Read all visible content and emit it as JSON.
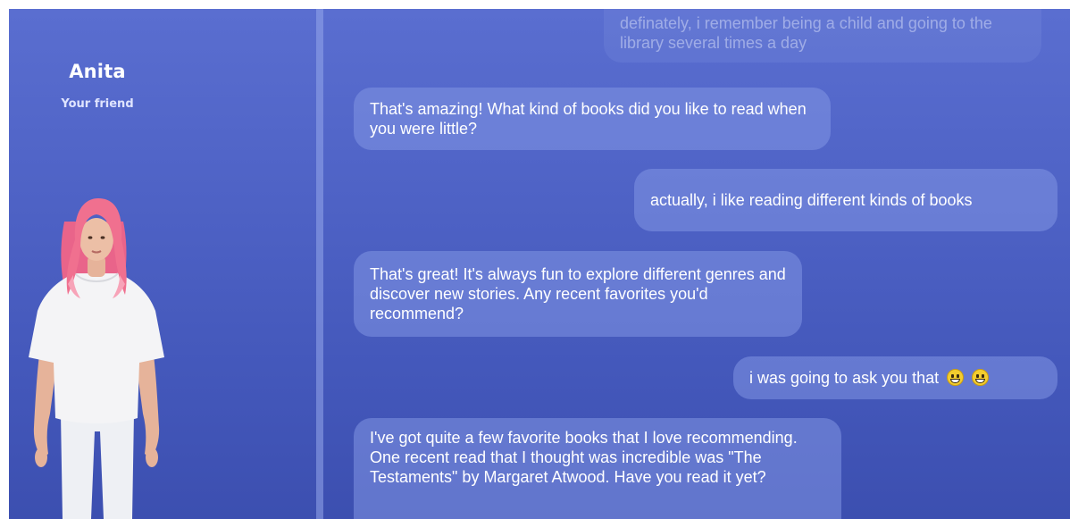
{
  "contact": {
    "name": "Anita",
    "role": "Your friend",
    "hair_color": "#f0708f",
    "shirt_color": "#f4f4f6"
  },
  "messages": [
    {
      "sender": "user",
      "text": "definately, i remember being a child and going to the library several times a day"
    },
    {
      "sender": "friend",
      "text": "That's amazing! What kind of books did you like to read when you were little?"
    },
    {
      "sender": "user",
      "text": "actually, i like reading different kinds of books"
    },
    {
      "sender": "friend",
      "text": "That's great! It's always fun to explore different genres and discover new stories. Any recent favorites you'd recommend?"
    },
    {
      "sender": "user",
      "text": "i was going to ask you that",
      "emojis": [
        "grinning-face-emoji",
        "grinning-face-emoji"
      ]
    },
    {
      "sender": "friend",
      "text": "I've got quite a few favorite books that I love recommending. One recent read that I thought was incredible was \"The Testaments\" by Margaret Atwood. Have you read it yet?"
    }
  ],
  "colors": {
    "background_top": "#5a6ed0",
    "background_bottom": "#3c4fb0",
    "bubble": "#8296e4",
    "text": "#ffffff"
  }
}
